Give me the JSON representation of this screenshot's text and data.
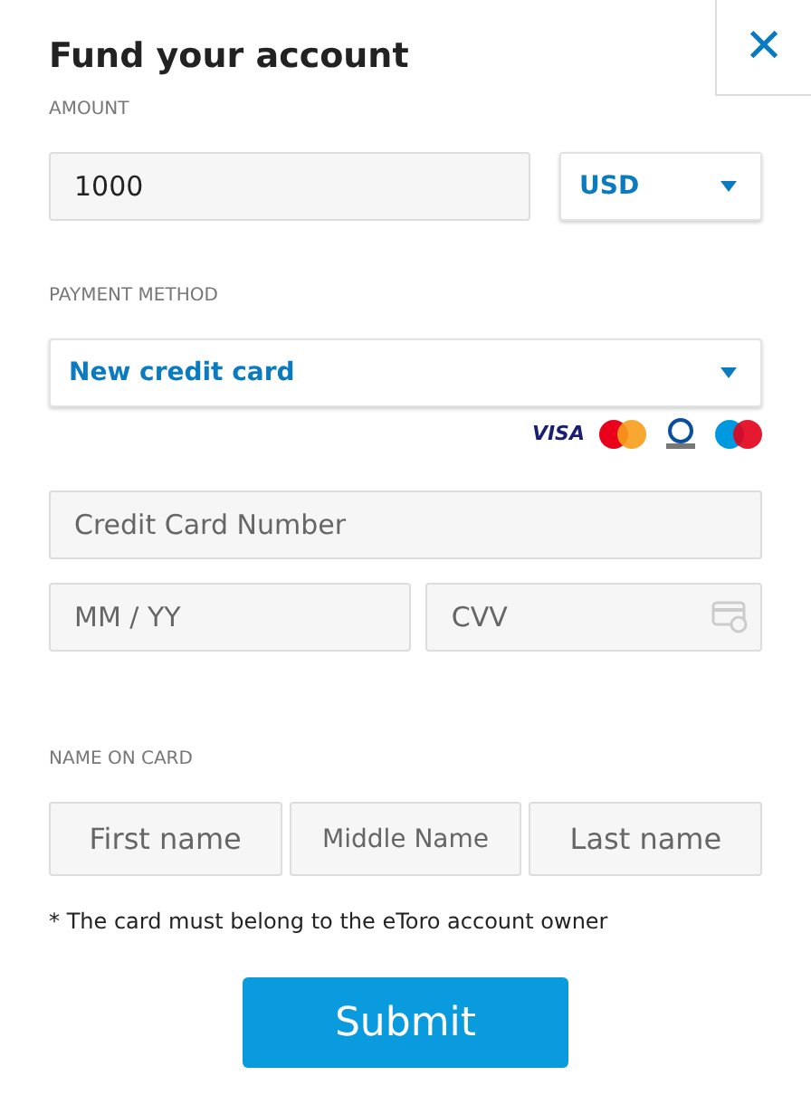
{
  "title": "Fund your account",
  "close": {
    "glyph": "✕"
  },
  "amount": {
    "label": "AMOUNT",
    "value": "1000",
    "currency": "USD"
  },
  "payment": {
    "label": "PAYMENT METHOD",
    "method": "New credit card",
    "brand_text": "VISA"
  },
  "card": {
    "number_placeholder": "Credit Card Number",
    "expiry_placeholder": "MM / YY",
    "cvv_placeholder": "CVV"
  },
  "name": {
    "label": "NAME ON CARD",
    "fields": [
      {
        "placeholder": "First name"
      },
      {
        "placeholder": "Middle Name"
      },
      {
        "placeholder": "Last name"
      }
    ]
  },
  "note": "* The card must belong to the eToro account owner",
  "submit": "Submit"
}
